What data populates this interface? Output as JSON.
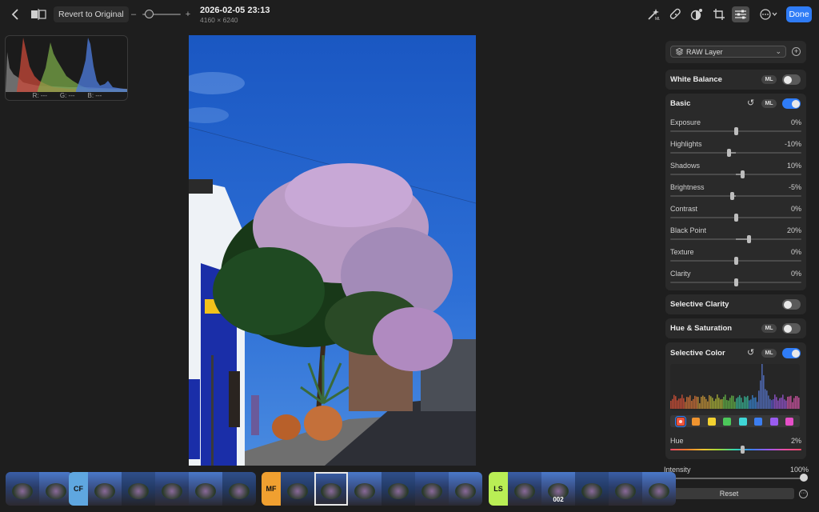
{
  "toolbar": {
    "revert_label": "Revert to Original",
    "zoom_minus": "–",
    "zoom_plus": "+",
    "title": "2026-02-05 23:13",
    "dimensions": "4160 × 6240",
    "done_label": "Done",
    "tools": [
      "magic-wand-icon",
      "bandage-icon",
      "filter-circle-icon",
      "crop-icon",
      "adjust-sliders-icon",
      "more-icon"
    ]
  },
  "histogram": {
    "r_label": "R: ---",
    "g_label": "G: ---",
    "b_label": "B: ---"
  },
  "panel": {
    "layer_label": "RAW Layer",
    "white_balance": {
      "title": "White Balance",
      "ml": "ML",
      "enabled": false
    },
    "basic": {
      "title": "Basic",
      "ml": "ML",
      "enabled": true,
      "sliders": [
        {
          "label": "Exposure",
          "value": "0%",
          "pos": 0.5
        },
        {
          "label": "Highlights",
          "value": "-10%",
          "pos": 0.45
        },
        {
          "label": "Shadows",
          "value": "10%",
          "pos": 0.55
        },
        {
          "label": "Brightness",
          "value": "-5%",
          "pos": 0.475
        },
        {
          "label": "Contrast",
          "value": "0%",
          "pos": 0.5
        },
        {
          "label": "Black Point",
          "value": "20%",
          "pos": 0.6
        },
        {
          "label": "Texture",
          "value": "0%",
          "pos": 0.5
        },
        {
          "label": "Clarity",
          "value": "0%",
          "pos": 0.5
        }
      ]
    },
    "selective_clarity": {
      "title": "Selective Clarity",
      "enabled": false
    },
    "hue_saturation": {
      "title": "Hue & Saturation",
      "ml": "ML",
      "enabled": false
    },
    "selective_color": {
      "title": "Selective Color",
      "ml": "ML",
      "enabled": true,
      "swatches": [
        "#f0523a",
        "#f0942f",
        "#f3d230",
        "#4cc85a",
        "#3fd6d6",
        "#3c7ef0",
        "#9a5cf0",
        "#e64fc8"
      ],
      "selected_swatch": 0,
      "hue_label": "Hue",
      "hue_value": "2%",
      "hue_pos": 0.55
    },
    "intensity_label": "Intensity",
    "intensity_value": "100%",
    "reset_label": "Reset"
  },
  "filmstrip": {
    "groups": [
      {
        "label": "",
        "color": "",
        "count": 2
      },
      {
        "label": "CF",
        "color": "#5fa7e0",
        "count": 5
      },
      {
        "label": "MF",
        "color": "#f0a030",
        "count": 6,
        "selected": 1
      },
      {
        "label": "LS",
        "color": "#b9ee55",
        "count": 5,
        "numbered": 1,
        "number": "002"
      }
    ]
  }
}
